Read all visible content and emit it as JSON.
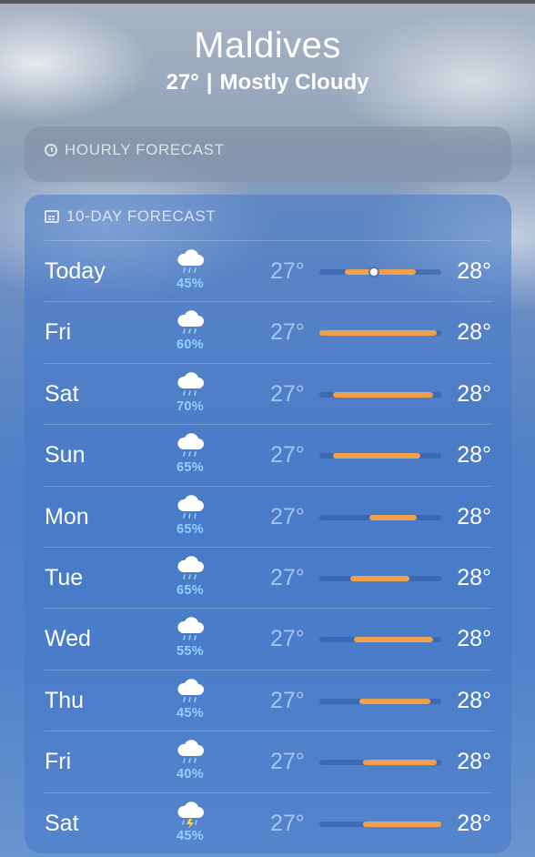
{
  "location": {
    "city": "Maldives",
    "temp": "27°",
    "separator": "|",
    "condition": "Mostly Cloudy"
  },
  "hourly": {
    "title": "HOURLY FORECAST",
    "icon": "clock-icon"
  },
  "ten_day": {
    "title": "10-DAY FORECAST",
    "icon": "calendar-icon",
    "bar_color": "#f0a04c",
    "days": [
      {
        "day": "Today",
        "icon": "cloud-rain-icon",
        "pop": "45%",
        "low": "27°",
        "high": "28°",
        "range": [
          0.21,
          0.79
        ],
        "current": 0.45
      },
      {
        "day": "Fri",
        "icon": "cloud-rain-icon",
        "pop": "60%",
        "low": "27°",
        "high": "28°",
        "range": [
          0.0,
          0.96
        ]
      },
      {
        "day": "Sat",
        "icon": "cloud-rain-icon",
        "pop": "70%",
        "low": "27°",
        "high": "28°",
        "range": [
          0.11,
          0.93
        ]
      },
      {
        "day": "Sun",
        "icon": "cloud-rain-icon",
        "pop": "65%",
        "low": "27°",
        "high": "28°",
        "range": [
          0.11,
          0.83
        ]
      },
      {
        "day": "Mon",
        "icon": "cloud-rain-icon",
        "pop": "65%",
        "low": "27°",
        "high": "28°",
        "range": [
          0.41,
          0.8
        ]
      },
      {
        "day": "Tue",
        "icon": "cloud-rain-icon",
        "pop": "65%",
        "low": "27°",
        "high": "28°",
        "range": [
          0.25,
          0.74
        ]
      },
      {
        "day": "Wed",
        "icon": "cloud-rain-icon",
        "pop": "55%",
        "low": "27°",
        "high": "28°",
        "range": [
          0.28,
          0.93
        ]
      },
      {
        "day": "Thu",
        "icon": "cloud-rain-icon",
        "pop": "45%",
        "low": "27°",
        "high": "28°",
        "range": [
          0.33,
          0.91
        ]
      },
      {
        "day": "Fri",
        "icon": "cloud-rain-icon",
        "pop": "40%",
        "low": "27°",
        "high": "28°",
        "range": [
          0.36,
          0.96
        ]
      },
      {
        "day": "Sat",
        "icon": "cloud-bolt-rain-icon",
        "pop": "45%",
        "low": "27°",
        "high": "28°",
        "range": [
          0.36,
          1.0
        ]
      }
    ]
  }
}
